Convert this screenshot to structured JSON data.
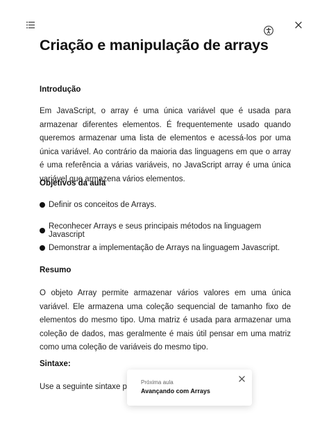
{
  "header": {
    "menu_icon": "list-icon",
    "accessibility_icon": "accessibility-icon",
    "close_icon": "close-icon"
  },
  "lesson": {
    "title": "Criação e manipulação de arrays",
    "intro_heading": "Introdução",
    "intro_text": "Em JavaScript, o array é uma única variável que é usada para armazenar diferentes elementos. É frequentemente usado quando queremos armazenar uma lista de elementos e acessá-los por uma única variável. Ao contrário da maioria das linguagens em que o array é uma referência a várias variáveis, no JavaScript array é uma única variável que armazena vários elementos.",
    "objectives_heading": "Objetivos da aula",
    "objectives": [
      "Definir os conceitos de Arrays.",
      "Reconhecer Arrays e seus principais métodos na linguagem Javascript",
      "Demonstrar a implementação de Arrays na linguagem Javascript."
    ],
    "summary_heading": "Resumo",
    "summary_text": "O objeto Array permite armazenar vários valores em uma única variável. Ele armazena uma coleção sequencial de tamanho fixo de elementos do mesmo tipo. Uma matriz é usada para armazenar uma coleção de dados, mas geralmente é mais útil pensar em uma matriz como uma coleção de variáveis do mesmo tipo.",
    "syntax_heading": "Sintaxe:",
    "syntax_text": "Use a seguinte sintaxe para"
  },
  "next_lesson_toast": {
    "label": "Próxima aula",
    "title": "Avançando com Arrays"
  }
}
